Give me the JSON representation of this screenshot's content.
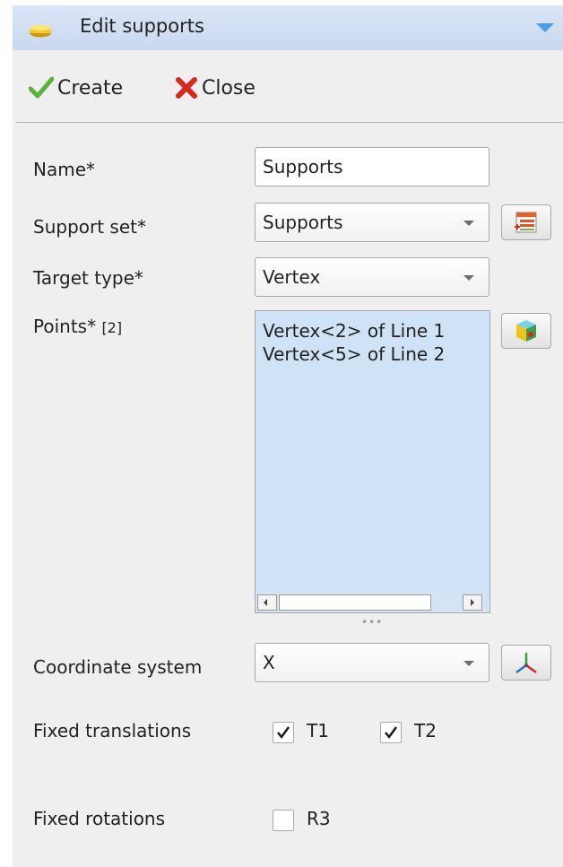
{
  "panel": {
    "title": "Edit supports",
    "collapse_icon": "chevron-down-icon"
  },
  "toolbar": {
    "create_label": "Create",
    "close_label": "Close"
  },
  "form": {
    "name": {
      "label": "Name*",
      "value": "Supports"
    },
    "support_set": {
      "label": "Support set*",
      "value": "Supports",
      "button_icon": "new-support-set-icon"
    },
    "target_type": {
      "label": "Target type*",
      "value": "Vertex"
    },
    "points": {
      "label": "Points*",
      "count": "[2]",
      "items": [
        "Vertex<2> of Line 1",
        "Vertex<5> of Line 2"
      ],
      "button_icon": "select-geometry-icon"
    },
    "coordinate_system": {
      "label": "Coordinate system",
      "value": "X",
      "button_icon": "axes-icon"
    },
    "fixed_translations": {
      "label": "Fixed translations",
      "options": [
        {
          "label": "T1",
          "checked": true
        },
        {
          "label": "T2",
          "checked": true
        }
      ]
    },
    "fixed_rotations": {
      "label": "Fixed rotations",
      "options": [
        {
          "label": "R3",
          "checked": false
        }
      ]
    }
  },
  "colors": {
    "title_bar": "#c9d8ef",
    "list_background": "#cfe2f6",
    "accent_arrow": "#4d9be0",
    "create_check": "#5ab43c",
    "close_cross": "#d42a1e"
  }
}
